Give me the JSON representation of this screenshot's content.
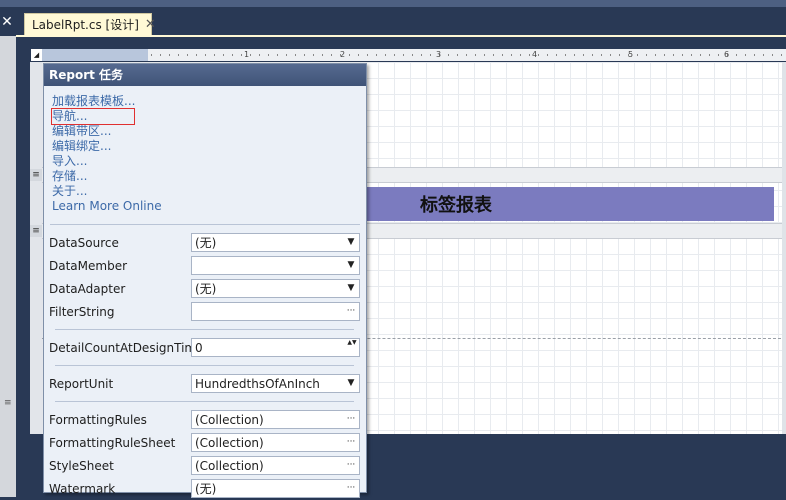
{
  "window": {
    "close_glyph": "✕",
    "tab_title": "LabelRpt.cs [设计]",
    "tab_close": "✕"
  },
  "ruler": {
    "corner_glyph": "◢",
    "labels": [
      "1",
      "2",
      "3",
      "4",
      "5",
      "6"
    ],
    "left_mark": "≡"
  },
  "report": {
    "title_label": "标签报表"
  },
  "panel": {
    "title": "Report 任务",
    "links": [
      "加载报表模板...",
      "导航...",
      "编辑带区...",
      "编辑绑定...",
      "导入...",
      "存储...",
      "关于...",
      "Learn More Online"
    ],
    "properties": [
      {
        "label": "DataSource",
        "value": "(无)",
        "button": "▼"
      },
      {
        "label": "DataMember",
        "value": "",
        "button": "▼"
      },
      {
        "label": "DataAdapter",
        "value": "(无)",
        "button": "▼"
      },
      {
        "label": "FilterString",
        "value": "",
        "button": "···"
      },
      {
        "label": "DetailCountAtDesignTime",
        "value": "0",
        "button": "▲▼"
      },
      {
        "label": "ReportUnit",
        "value": "HundredthsOfAnInch",
        "button": "▼"
      },
      {
        "label": "FormattingRules",
        "value": "(Collection)",
        "button": "···"
      },
      {
        "label": "FormattingRuleSheet",
        "value": "(Collection)",
        "button": "···"
      },
      {
        "label": "StyleSheet",
        "value": "(Collection)",
        "button": "···"
      },
      {
        "label": "Watermark",
        "value": "(无)",
        "button": "···"
      }
    ]
  }
}
